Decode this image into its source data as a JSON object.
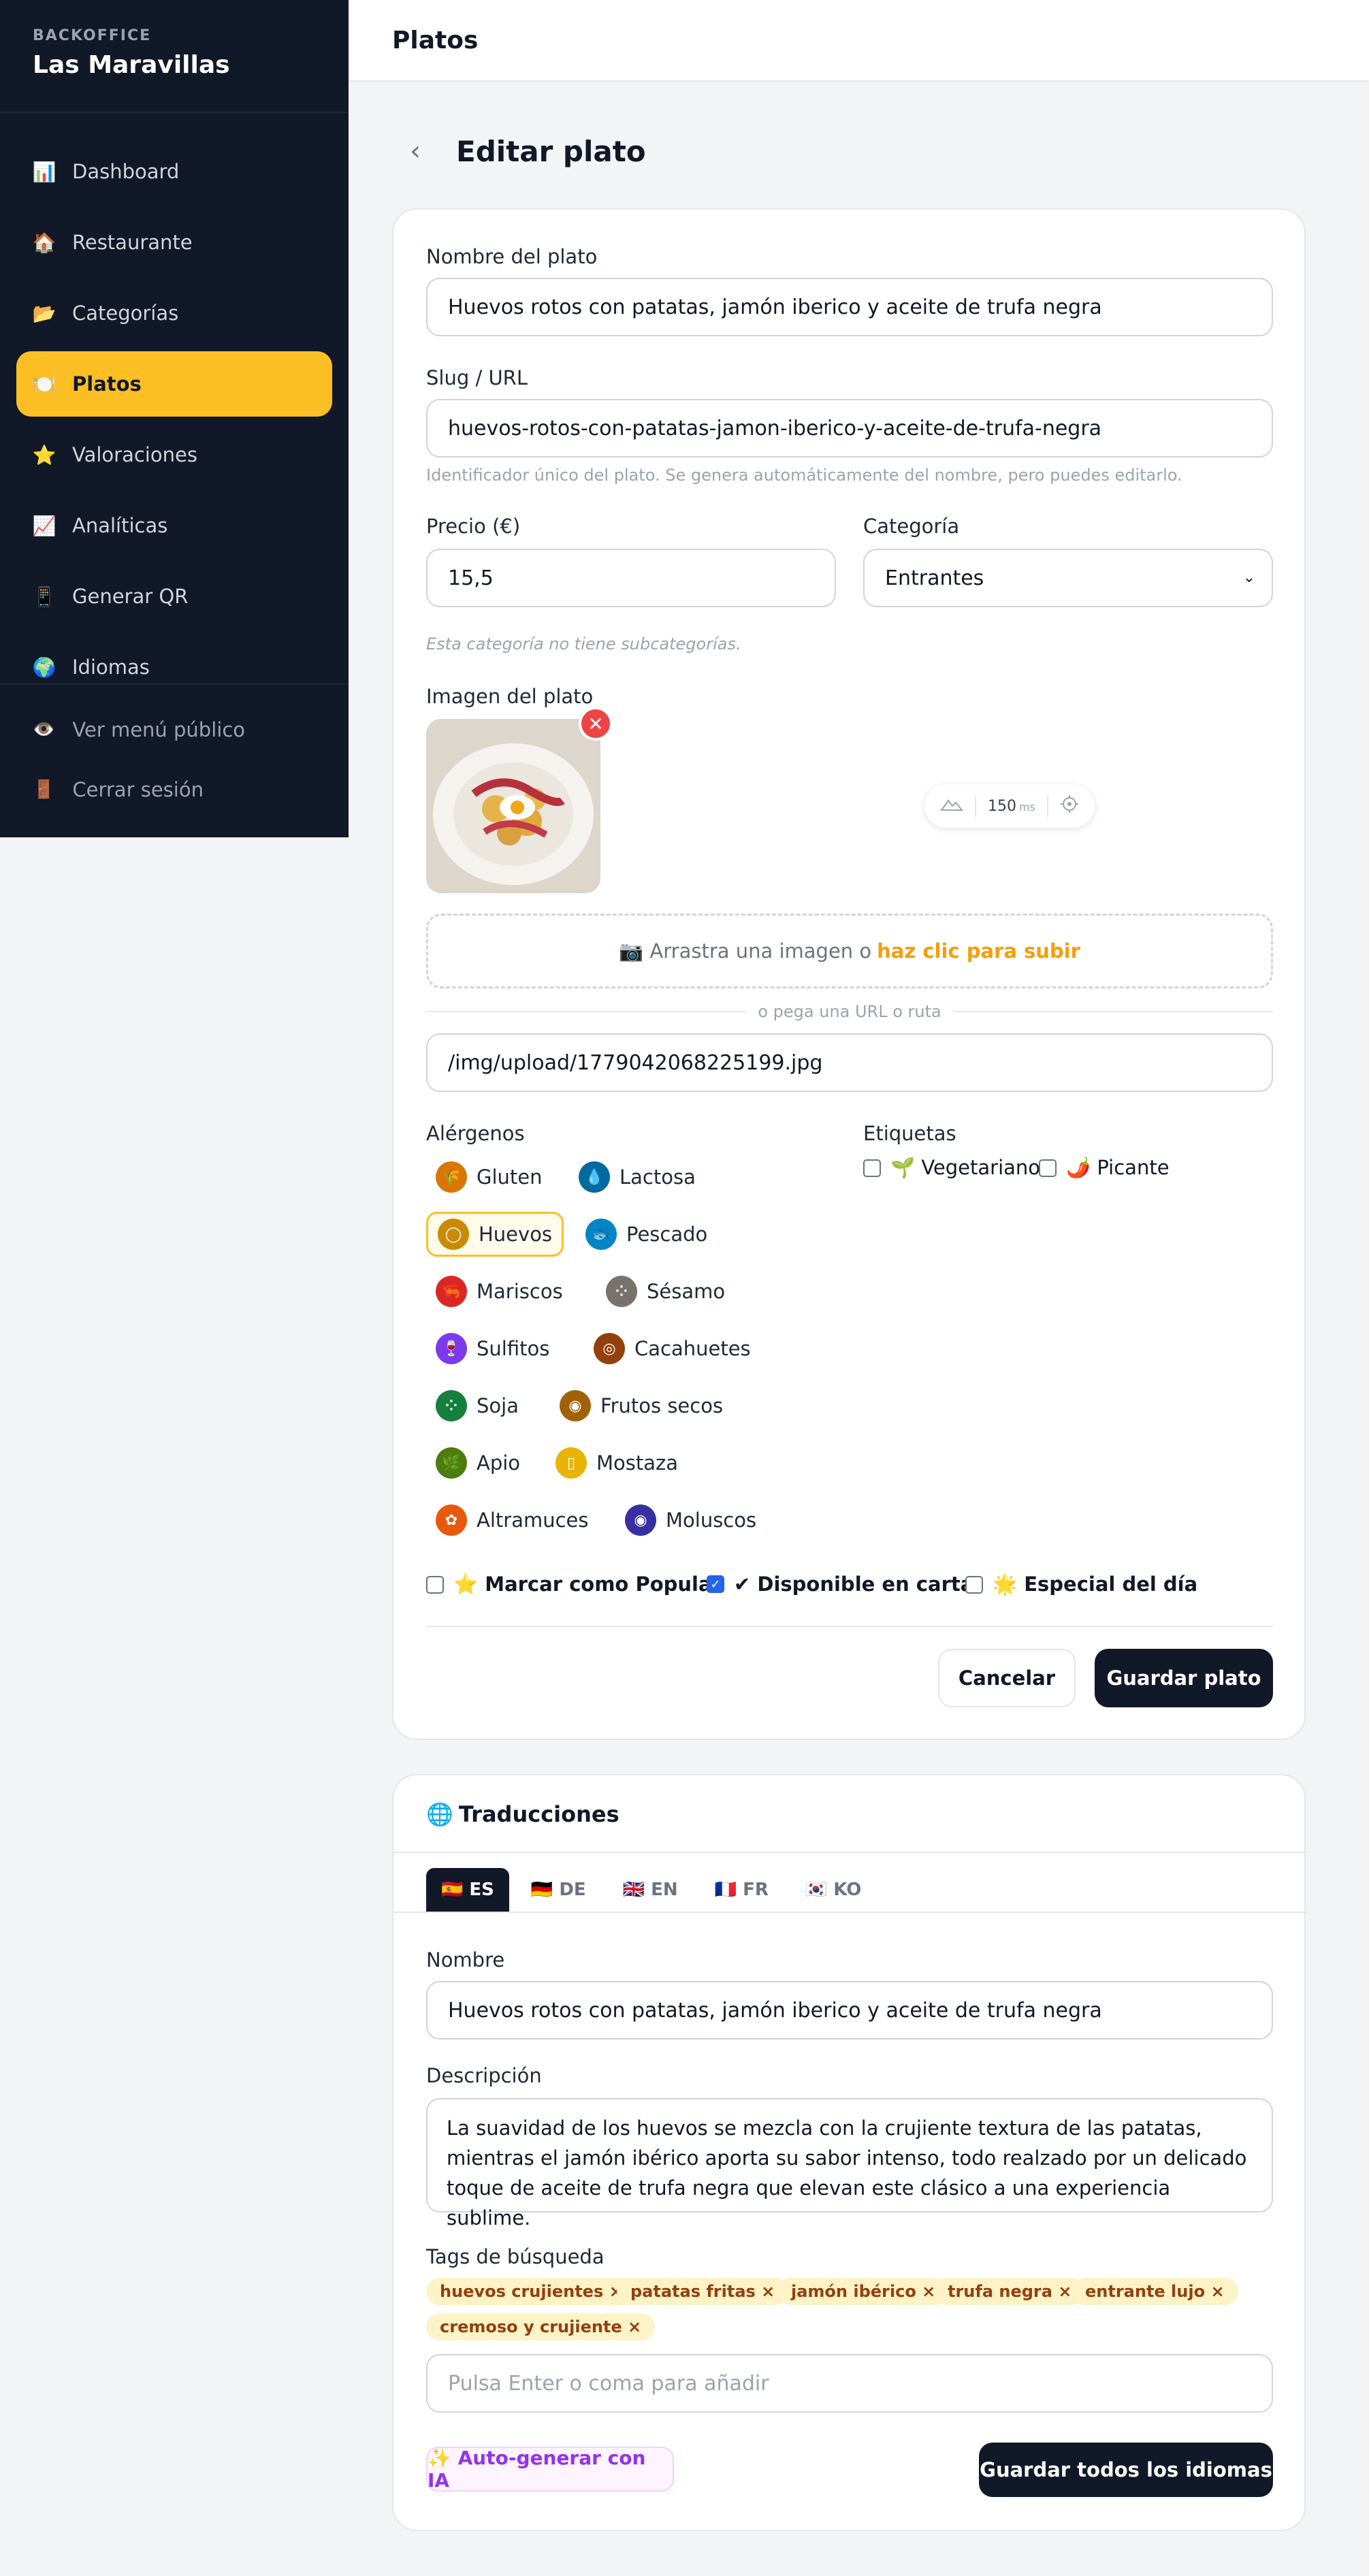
{
  "sidebar": {
    "kicker": "BACKOFFICE",
    "title": "Las Maravillas",
    "items": [
      {
        "icon": "📊",
        "label": "Dashboard"
      },
      {
        "icon": "🏠",
        "label": "Restaurante"
      },
      {
        "icon": "📂",
        "label": "Categorías"
      },
      {
        "icon": "🍽️",
        "label": "Platos"
      },
      {
        "icon": "⭐",
        "label": "Valoraciones"
      },
      {
        "icon": "📈",
        "label": "Analíticas"
      },
      {
        "icon": "📱",
        "label": "Generar QR"
      },
      {
        "icon": "🌍",
        "label": "Idiomas"
      }
    ],
    "public_menu": {
      "icon": "👁️",
      "label": "Ver menú público"
    },
    "logout": {
      "icon": "🚪",
      "label": "Cerrar sesión"
    }
  },
  "header": {
    "title": "Platos"
  },
  "page": {
    "title": "Editar plato",
    "back_icon": "‹"
  },
  "form": {
    "name_label": "Nombre del plato",
    "name_value": "Huevos rotos con patatas, jamón iberico y aceite de trufa negra",
    "slug_label": "Slug / URL",
    "slug_value": "huevos-rotos-con-patatas-jamon-iberico-y-aceite-de-trufa-negra",
    "slug_hint": "Identificador único del plato. Se genera automáticamente del nombre, pero puedes editarlo.",
    "price_label": "Precio (€)",
    "price_value": "15,5",
    "category_label": "Categoría",
    "category_value": "Entrantes",
    "subcat_hint": "Esta categoría no tiene subcategorías.",
    "image_label": "Imagen del plato",
    "remove_icon": "✕",
    "latency_value": "150",
    "latency_unit": "ms",
    "drop_text": "📷 Arrastra una imagen o",
    "drop_link": "haz clic para subir",
    "or_text": "o pega una URL o ruta",
    "image_path": "/img/upload/1779042068225199.jpg",
    "allergens_label": "Alérgenos",
    "tags_label": "Etiquetas",
    "allergens": [
      {
        "label": "Gluten",
        "color": "#d97706",
        "glyph": "🌾"
      },
      {
        "label": "Lactosa",
        "color": "#0369a1",
        "glyph": "💧"
      },
      {
        "label": "Huevos",
        "color": "#ca8a04",
        "glyph": "◯"
      },
      {
        "label": "Pescado",
        "color": "#0284c7",
        "glyph": "🐟"
      },
      {
        "label": "Mariscos",
        "color": "#dc2626",
        "glyph": "🦐"
      },
      {
        "label": "Sésamo",
        "color": "#78716c",
        "glyph": "⁘"
      },
      {
        "label": "Sulfitos",
        "color": "#7c3aed",
        "glyph": "🍷"
      },
      {
        "label": "Cacahuetes",
        "color": "#92400e",
        "glyph": "◎"
      },
      {
        "label": "Soja",
        "color": "#15803d",
        "glyph": "⁘"
      },
      {
        "label": "Frutos secos",
        "color": "#a16207",
        "glyph": "◉"
      },
      {
        "label": "Apio",
        "color": "#4d7c0f",
        "glyph": "🌿"
      },
      {
        "label": "Mostaza",
        "color": "#eab308",
        "glyph": "▯"
      },
      {
        "label": "Altramuces",
        "color": "#ea580c",
        "glyph": "✿"
      },
      {
        "label": "Moluscos",
        "color": "#3730a3",
        "glyph": "◉"
      }
    ],
    "tag_vegetarian": "🌱 Vegetariano",
    "tag_spicy": "🌶️ Picante",
    "popular_label": "⭐ Marcar como Popular",
    "available_label": "✔ Disponible en carta",
    "special_label": "🌟 Especial del día",
    "cancel": "Cancelar",
    "save": "Guardar plato"
  },
  "translations": {
    "title": "Traducciones",
    "title_icon": "🌐",
    "tabs": [
      "🇪🇸 ES",
      "🇩🇪 DE",
      "🇬🇧 EN",
      "🇫🇷 FR",
      "🇰🇷 KO"
    ],
    "name_label": "Nombre",
    "name_value": "Huevos rotos con patatas, jamón iberico y aceite de trufa negra",
    "desc_label": "Descripción",
    "desc_value": "La suavidad de los huevos se mezcla con la crujiente textura de las patatas, mientras el jamón ibérico aporta su sabor intenso, todo realzado por un delicado toque de aceite de trufa negra que elevan este clásico a una experiencia sublime.",
    "tags_label": "Tags de búsqueda",
    "tags": [
      "huevos crujientes ×",
      "patatas fritas ×",
      "jamón ibérico ×",
      "trufa negra ×",
      "entrante lujo ×",
      "cremoso y crujiente ×"
    ],
    "tags_placeholder": "Pulsa Enter o coma para añadir",
    "ai_button": "✨ Auto-generar con IA",
    "save_all": "Guardar todos los idiomas"
  }
}
